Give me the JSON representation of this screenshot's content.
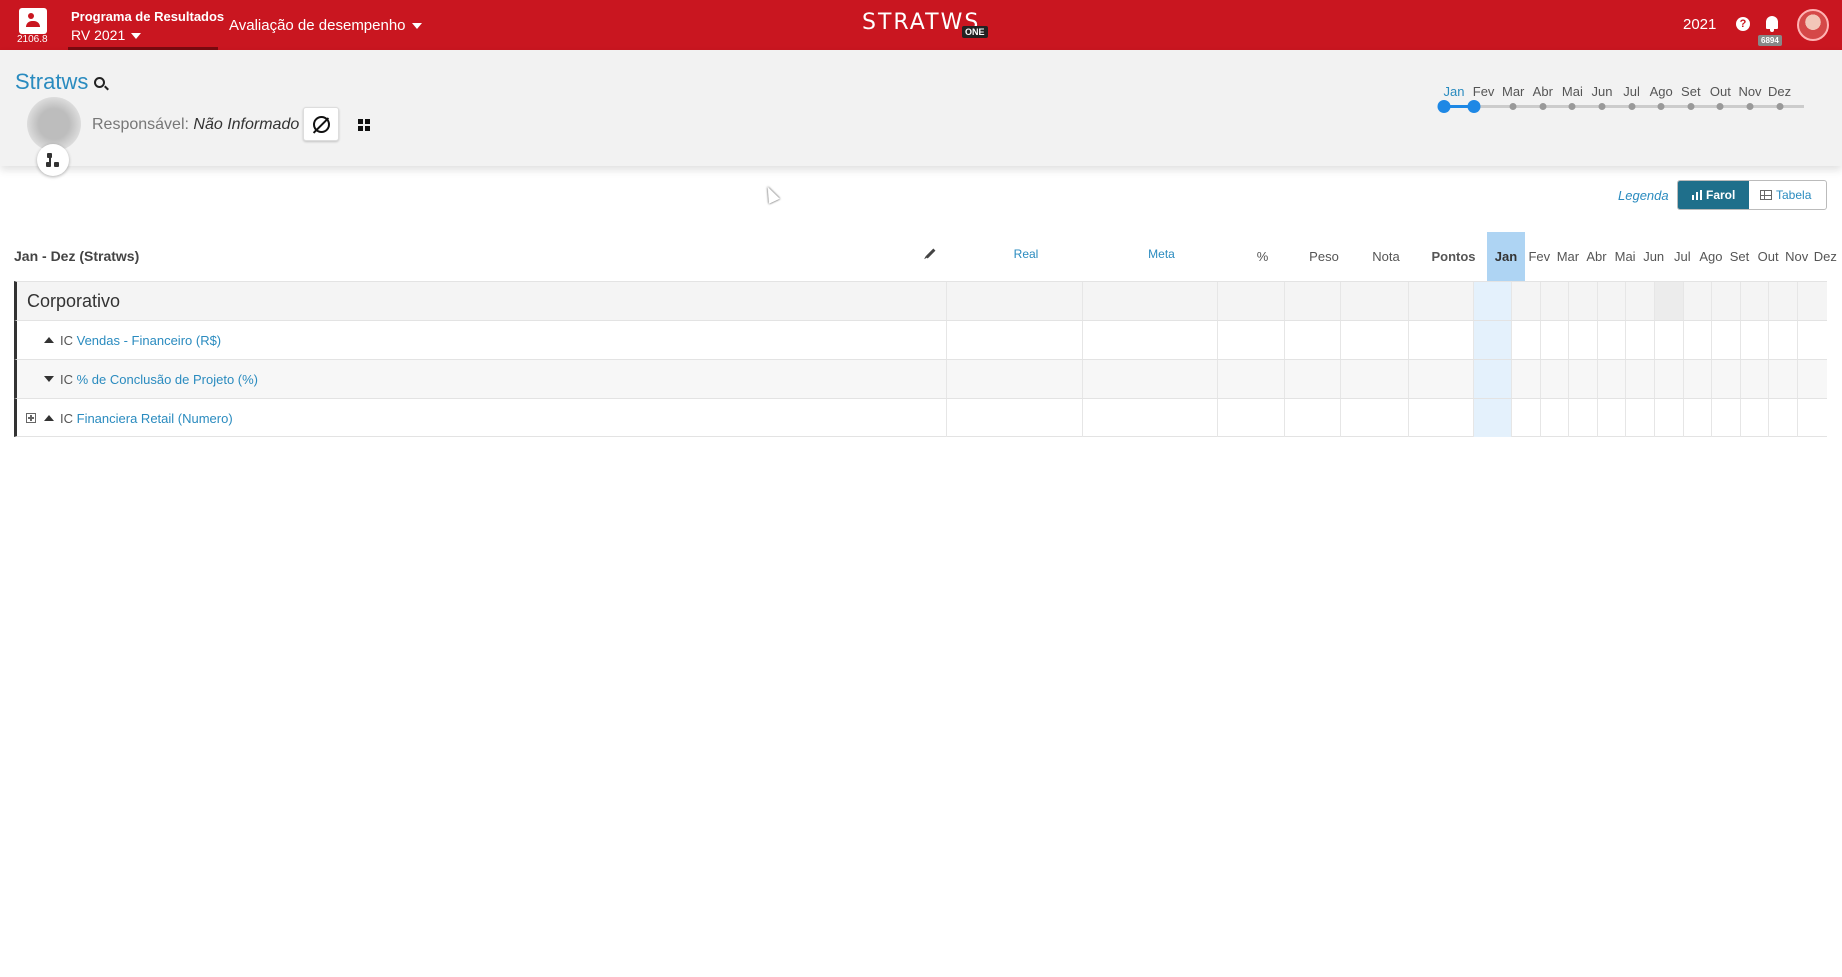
{
  "app": {
    "version": "2106.8",
    "program_title": "Programa de Resultados",
    "program_cycle": "RV 2021",
    "eval_menu": "Avaliação de desempenho",
    "logo_text": "STRATWS",
    "logo_badge": "ONE",
    "year": "2021",
    "help": "?",
    "notifications": "6894",
    "accent_color": "#c91620"
  },
  "header": {
    "title": "Stratws",
    "responsavel_label": "Responsável:",
    "responsavel_value": "Não Informado",
    "timeline": {
      "months": [
        "Jan",
        "Fev",
        "Mar",
        "Abr",
        "Mai",
        "Jun",
        "Jul",
        "Ago",
        "Set",
        "Out",
        "Nov",
        "Dez"
      ],
      "selected_from": "Jan",
      "selected_to": "Fev"
    }
  },
  "view": {
    "legend": "Legenda",
    "farol": "Farol",
    "tabela": "Tabela"
  },
  "table": {
    "period": "Jan - Dez (Stratws)",
    "columns": {
      "real": "Real",
      "meta": "Meta",
      "pct": "%",
      "peso": "Peso",
      "nota": "Nota",
      "pontos": "Pontos"
    },
    "months": [
      "Jan",
      "Fev",
      "Mar",
      "Abr",
      "Mai",
      "Jun",
      "Jul",
      "Ago",
      "Set",
      "Out",
      "Nov",
      "Dez"
    ],
    "group": "Corporativo",
    "rows": [
      {
        "prefix": "IC",
        "name": "Vendas - Financeiro (R$)",
        "trend": "up",
        "expandable": false
      },
      {
        "prefix": "IC",
        "name": "% de Conclusão de Projeto (%)",
        "trend": "down",
        "expandable": false
      },
      {
        "prefix": "IC",
        "name": "Financiera Retail (Numero)",
        "trend": "up",
        "expandable": true
      }
    ]
  }
}
